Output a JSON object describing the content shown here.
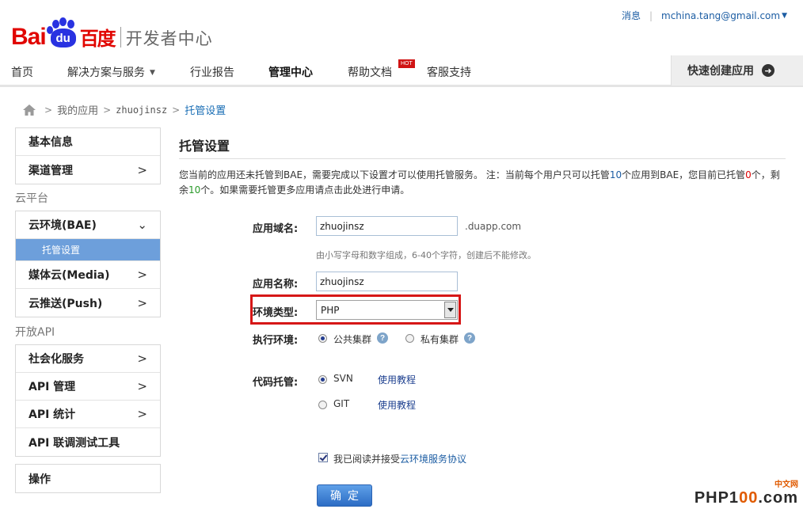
{
  "logo": {
    "bai": "Bai",
    "du": "du",
    "cn": "百度",
    "sub": "开发者中心"
  },
  "top_links": {
    "messages": "消息",
    "user": "mchina.tang@gmail.com"
  },
  "nav": {
    "items": [
      "首页",
      "解决方案与服务",
      "行业报告",
      "管理中心",
      "帮助文档",
      "客服支持"
    ],
    "hot_badge": "HOT",
    "create_app": "快速创建应用"
  },
  "breadcrumb": {
    "my_apps": "我的应用",
    "app": "zhuojinsz",
    "current": "托管设置"
  },
  "sidebar": {
    "basic_info": "基本信息",
    "channel_mgmt": "渠道管理",
    "section_cloud": "云平台",
    "bae": "云环境(BAE)",
    "hosting": "托管设置",
    "media": "媒体云(Media)",
    "push": "云推送(Push)",
    "section_api": "开放API",
    "social": "社会化服务",
    "api_mgmt": "API 管理",
    "api_stats": "API 统计",
    "api_debug": "API 联调测试工具",
    "operations": "操作"
  },
  "main": {
    "title": "托管设置",
    "notice": {
      "p1": "您当前的应用还未托管到BAE，需要完成以下设置才可以使用托管服务。 注：当前每个用户只可以托管",
      "n1": "10",
      "p2": "个应用到BAE，您目前已托管",
      "n2": "0",
      "p3": "个，剩余",
      "n3": "10",
      "p4": "个。如果需要托管更多应用请点击此处进行申请。"
    },
    "domain_label": "应用域名:",
    "domain_value": "zhuojinsz",
    "domain_suffix": ".duapp.com",
    "domain_hint": "由小写字母和数字组成，6-40个字符，创建后不能修改。",
    "name_label": "应用名称:",
    "name_value": "zhuojinsz",
    "env_label": "环境类型:",
    "env_value": "PHP",
    "exec_label": "执行环境:",
    "exec_public": "公共集群",
    "exec_private": "私有集群",
    "code_label": "代码托管:",
    "svn": "SVN",
    "git": "GIT",
    "tutorial": "使用教程",
    "agree_prefix": "我已阅读并接受",
    "agree_link": "云环境服务协议",
    "confirm": "确定"
  },
  "watermark": {
    "small": "中文网",
    "big_a": "PHP1",
    "big_o1": "0",
    "big_o2": "0",
    "big_b": ".com"
  },
  "colors": {
    "accent": "#1c5da3",
    "highlight": "#d61717",
    "selected": "#6d9fdb"
  }
}
